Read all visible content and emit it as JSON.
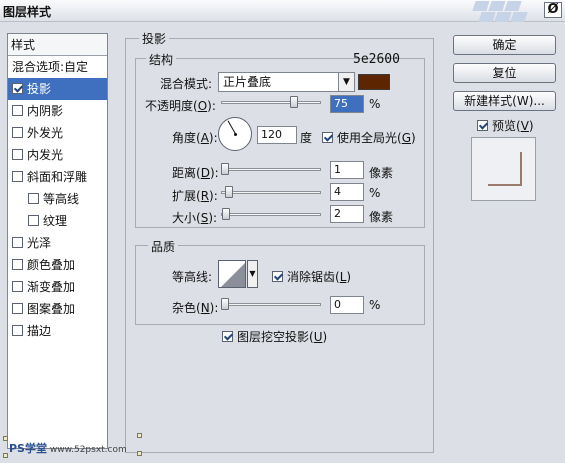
{
  "dialog": {
    "title": "图层样式",
    "close": "Ø"
  },
  "left_panel": {
    "header": "样式",
    "items": [
      {
        "label": "混合选项:自定",
        "checkbox": false,
        "selected": false,
        "indent": false,
        "checked": false
      },
      {
        "label": "投影",
        "checkbox": true,
        "checked": true,
        "selected": true,
        "indent": false
      },
      {
        "label": "内阴影",
        "checkbox": true,
        "checked": false,
        "selected": false,
        "indent": false
      },
      {
        "label": "外发光",
        "checkbox": true,
        "checked": false,
        "selected": false,
        "indent": false
      },
      {
        "label": "内发光",
        "checkbox": true,
        "checked": false,
        "selected": false,
        "indent": false
      },
      {
        "label": "斜面和浮雕",
        "checkbox": true,
        "checked": false,
        "selected": false,
        "indent": false
      },
      {
        "label": "等高线",
        "checkbox": true,
        "checked": false,
        "selected": false,
        "indent": true
      },
      {
        "label": "纹理",
        "checkbox": true,
        "checked": false,
        "selected": false,
        "indent": true
      },
      {
        "label": "光泽",
        "checkbox": true,
        "checked": false,
        "selected": false,
        "indent": false
      },
      {
        "label": "颜色叠加",
        "checkbox": true,
        "checked": false,
        "selected": false,
        "indent": false
      },
      {
        "label": "渐变叠加",
        "checkbox": true,
        "checked": false,
        "selected": false,
        "indent": false
      },
      {
        "label": "图案叠加",
        "checkbox": true,
        "checked": false,
        "selected": false,
        "indent": false
      },
      {
        "label": "描边",
        "checkbox": true,
        "checked": false,
        "selected": false,
        "indent": false
      }
    ]
  },
  "drop_shadow": {
    "group_title": "投影",
    "structure": {
      "title": "结构",
      "color_annotation": "5e2600",
      "blend_mode_label": "混合模式:",
      "blend_mode_value": "正片叠底",
      "color_swatch": "#5e2600",
      "opacity": {
        "label_pre": "不透明度(",
        "key": "O",
        "label_post": "):",
        "value": "75",
        "unit": "%",
        "fraction": 0.75
      },
      "angle": {
        "label_pre": "角度(",
        "key": "A",
        "label_post": "):",
        "value": "120",
        "unit": "度"
      },
      "global_light": {
        "label_pre": "使用全局光(",
        "key": "G",
        "label_post": ")",
        "checked": true
      },
      "distance": {
        "label_pre": "距离(",
        "key": "D",
        "label_post": "):",
        "value": "1",
        "unit": "像素",
        "fraction": 0.0
      },
      "spread": {
        "label_pre": "扩展(",
        "key": "R",
        "label_post": "):",
        "value": "4",
        "unit": "%",
        "fraction": 0.04
      },
      "size": {
        "label_pre": "大小(",
        "key": "S",
        "label_post": "):",
        "value": "2",
        "unit": "像素",
        "fraction": 0.01
      }
    },
    "quality": {
      "title": "品质",
      "contour_label": "等高线:",
      "anti_alias": {
        "label_pre": "消除锯齿(",
        "key": "L",
        "label_post": ")",
        "checked": true
      },
      "noise": {
        "label_pre": "杂色(",
        "key": "N",
        "label_post": "):",
        "value": "0",
        "unit": "%",
        "fraction": 0.0
      }
    },
    "knockout": {
      "label_pre": "图层挖空投影(",
      "key": "U",
      "label_post": ")",
      "checked": true
    }
  },
  "buttons": {
    "ok": "确定",
    "reset": "复位",
    "new_style": "新建样式(W)...",
    "preview_pre": "预览(",
    "preview_key": "V",
    "preview_post": ")",
    "preview_checked": true
  },
  "watermark": {
    "brand": "PS学堂",
    "site": "www.52psxt.com"
  }
}
